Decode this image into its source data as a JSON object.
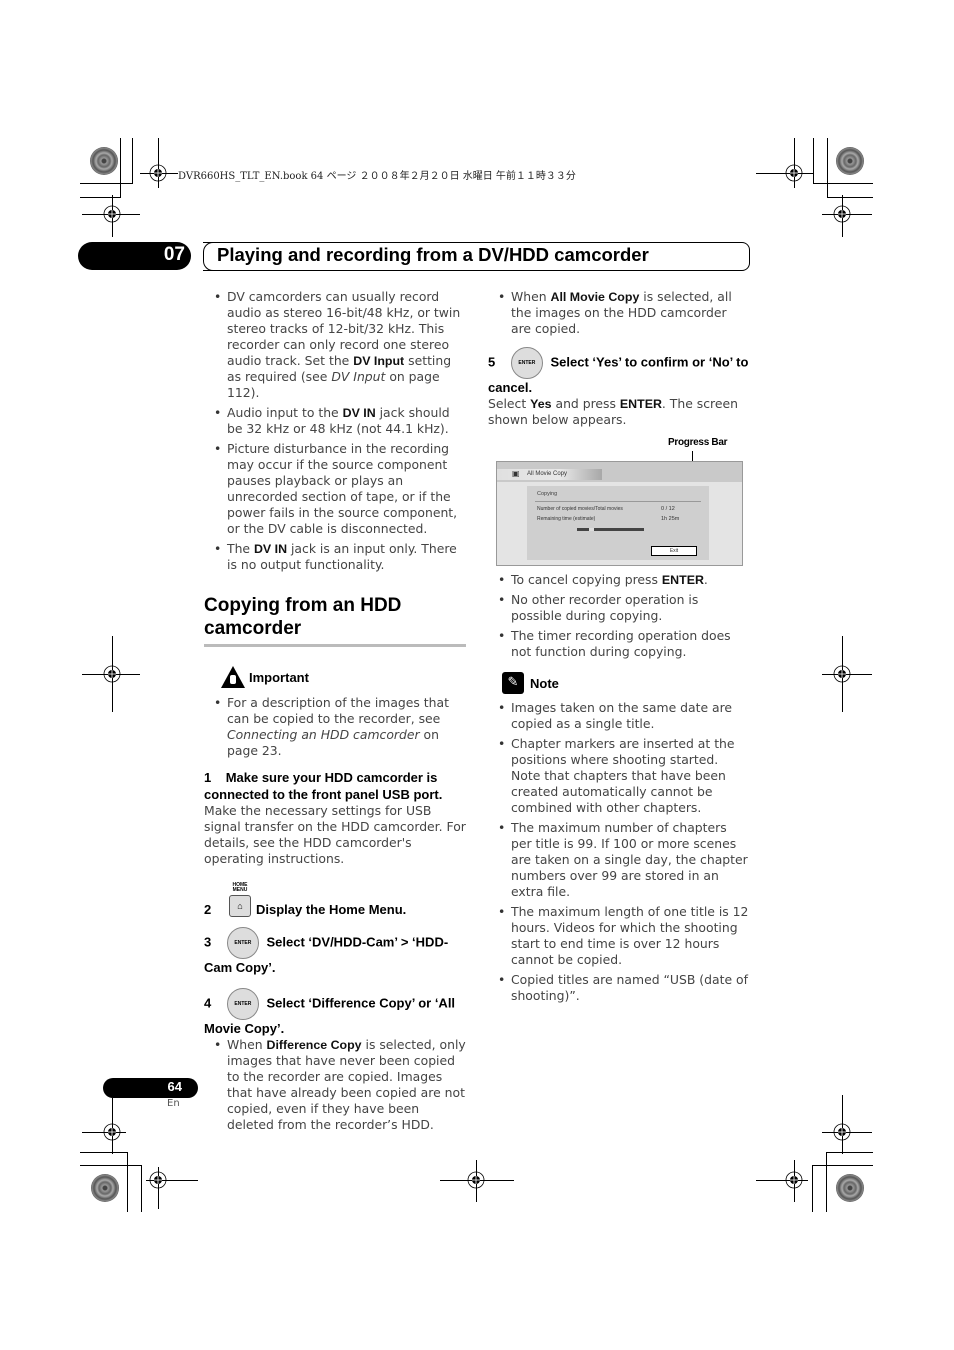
{
  "book_line": "DVR660HS_TLT_EN.book   64 ページ   ２００８年２月２０日   水曜日   午前１１時３３分",
  "header": {
    "chapter": "07",
    "title": "Playing and recording from a DV/HDD camcorder"
  },
  "left": {
    "bullets_top": [
      {
        "parts": [
          "DV camcorders can usually record audio as stereo 16-bit/48 kHz, or twin stereo tracks of 12-bit/32 kHz. This recorder can only record one stereo audio track. Set the ",
          "DV Input",
          " setting as required (see ",
          "DV Input",
          " on page 112)."
        ]
      },
      {
        "parts": [
          "Audio input to the ",
          "DV IN",
          " jack should be 32 kHz or 48 kHz (not 44.1 kHz)."
        ]
      },
      {
        "parts": [
          "Picture disturbance in the recording may occur if the source component pauses playback or plays an unrecorded section of tape, or if the power fails in the source component, or the DV cable is disconnected."
        ]
      },
      {
        "parts": [
          "The ",
          "DV IN",
          " jack is an input only. There is no output functionality."
        ]
      }
    ],
    "section_title": "Copying from an HDD camcorder",
    "important": {
      "label": "Important",
      "bullet": [
        "For a description of the images that can be copied to the recorder, see ",
        "Connecting an HDD camcorder",
        " on page 23."
      ]
    },
    "step1": {
      "num": "1",
      "title": "Make sure your HDD camcorder is connected to the front panel USB port.",
      "body": "Make the necessary settings for USB signal transfer on the HDD camcorder. For details, see the HDD camcorder's operating instructions."
    },
    "step2": {
      "num": "2",
      "icon_label": "HOME MENU",
      "title": "Display the Home Menu."
    },
    "step3": {
      "num": "3",
      "icon_label": "ENTER",
      "title": "Select ‘DV/HDD-Cam’ > ‘HDD-Cam Copy’."
    },
    "step4": {
      "num": "4",
      "icon_label": "ENTER",
      "title": "Select ‘Difference Copy’ or ‘All Movie Copy’.",
      "bullet": [
        "When ",
        "Difference Copy",
        " is selected, only images that have never been copied to the recorder are copied. Images that have already been copied are not copied, even if they have been deleted from the recorder’s HDD."
      ]
    }
  },
  "right": {
    "bullet_top": [
      "When ",
      "All Movie Copy",
      " is selected, all the images on the HDD camcorder are copied."
    ],
    "step5": {
      "num": "5",
      "icon_label": "ENTER",
      "title": "Select ‘Yes’ to confirm or ‘No’ to cancel.",
      "body": [
        "Select ",
        "Yes",
        " and press ",
        "ENTER",
        ". The screen shown below appears."
      ]
    },
    "callout": "Progress Bar",
    "screen": {
      "tab_label": "All Movie Copy",
      "panel_title": "Copying",
      "row1_label": "Number of copied movies/Total movies",
      "row1_value": "0 /  12",
      "row2_label": "Remaining time (estimate)",
      "row2_value": "1h 25m",
      "exit_label": "Exit"
    },
    "bullets_mid": [
      [
        "To cancel copying press ",
        "ENTER",
        "."
      ],
      [
        "No other recorder operation is possible during copying."
      ],
      [
        "The timer recording operation does not function during copying."
      ]
    ],
    "note": {
      "label": "Note",
      "bullets": [
        "Images taken on the same date are copied as a single title.",
        "Chapter markers are inserted at the positions where shooting started. Note that chapters that have been created automatically cannot be combined with other chapters.",
        "The maximum number of chapters per title is 99. If 100 or more scenes are taken on a single day, the chapter numbers over 99 are stored in an extra file.",
        "The maximum length of one title is 12 hours. Videos for which the shooting start to end time is over 12 hours cannot be copied.",
        "Copied titles are named “USB (date of shooting)”."
      ]
    }
  },
  "footer": {
    "page": "64",
    "lang": "En"
  }
}
